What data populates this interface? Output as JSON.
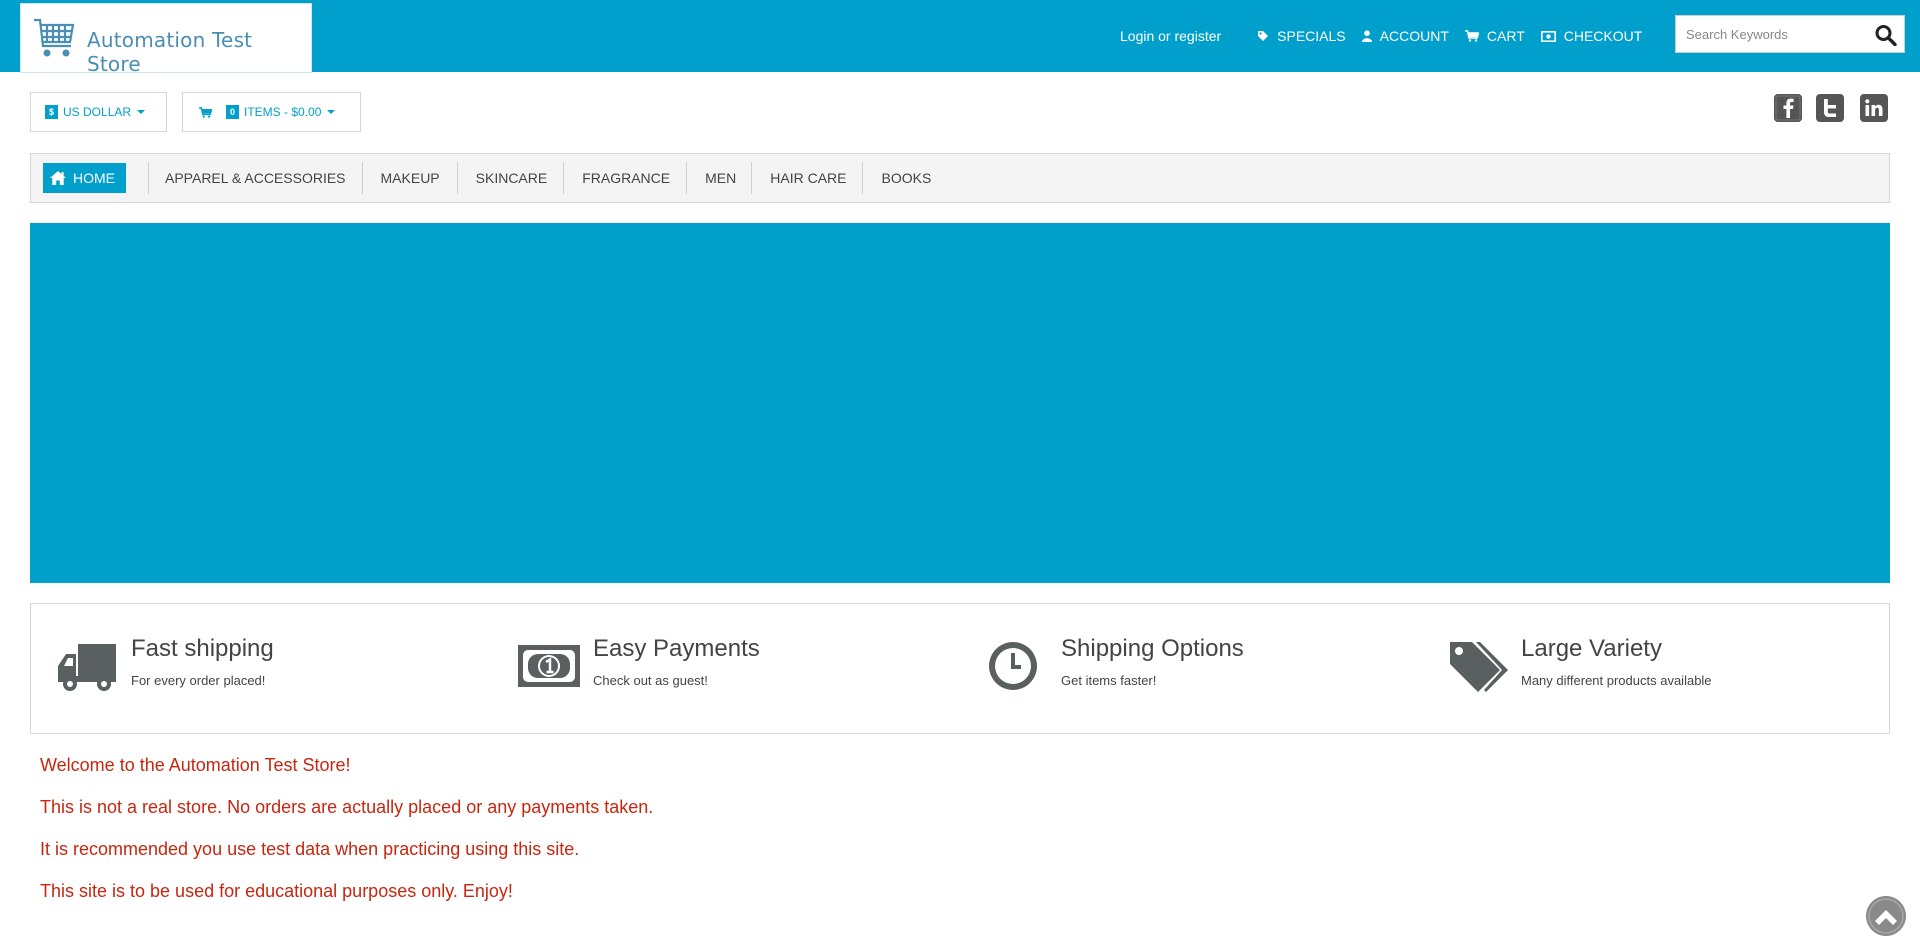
{
  "brand": {
    "name": "Automation Test Store",
    "accent": "#009fcc",
    "text_red": "#c8260f"
  },
  "header": {
    "login": "Login or register",
    "links": [
      {
        "label": "SPECIALS",
        "icon": "tag-icon"
      },
      {
        "label": "ACCOUNT",
        "icon": "user-icon"
      },
      {
        "label": "CART",
        "icon": "cart-icon"
      },
      {
        "label": "CHECKOUT",
        "icon": "money-icon"
      }
    ],
    "search": {
      "placeholder": "Search Keywords",
      "value": ""
    }
  },
  "toolbar": {
    "currency_symbol": "$",
    "currency": "US DOLLAR",
    "cart_count": "0",
    "cart_summary": "ITEMS - $0.00"
  },
  "social": [
    "facebook-icon",
    "twitter-icon",
    "linkedin-icon"
  ],
  "nav": {
    "home": "HOME",
    "items": [
      "APPAREL & ACCESSORIES",
      "MAKEUP",
      "SKINCARE",
      "FRAGRANCE",
      "MEN",
      "HAIR CARE",
      "BOOKS"
    ]
  },
  "features": [
    {
      "title": "Fast shipping",
      "subtitle": "For every order placed!",
      "icon": "truck-icon"
    },
    {
      "title": "Easy Payments",
      "subtitle": "Check out as guest!",
      "icon": "banknote-icon"
    },
    {
      "title": "Shipping Options",
      "subtitle": "Get items faster!",
      "icon": "clock-icon"
    },
    {
      "title": "Large Variety",
      "subtitle": "Many different products available",
      "icon": "tags-icon"
    }
  ],
  "welcome": [
    "Welcome to the Automation Test Store!",
    "This is not a real store. No orders are actually placed or any payments taken.",
    "It is recommended you use test data when practicing using this site.",
    "This site is to be used for educational purposes only. Enjoy!"
  ]
}
